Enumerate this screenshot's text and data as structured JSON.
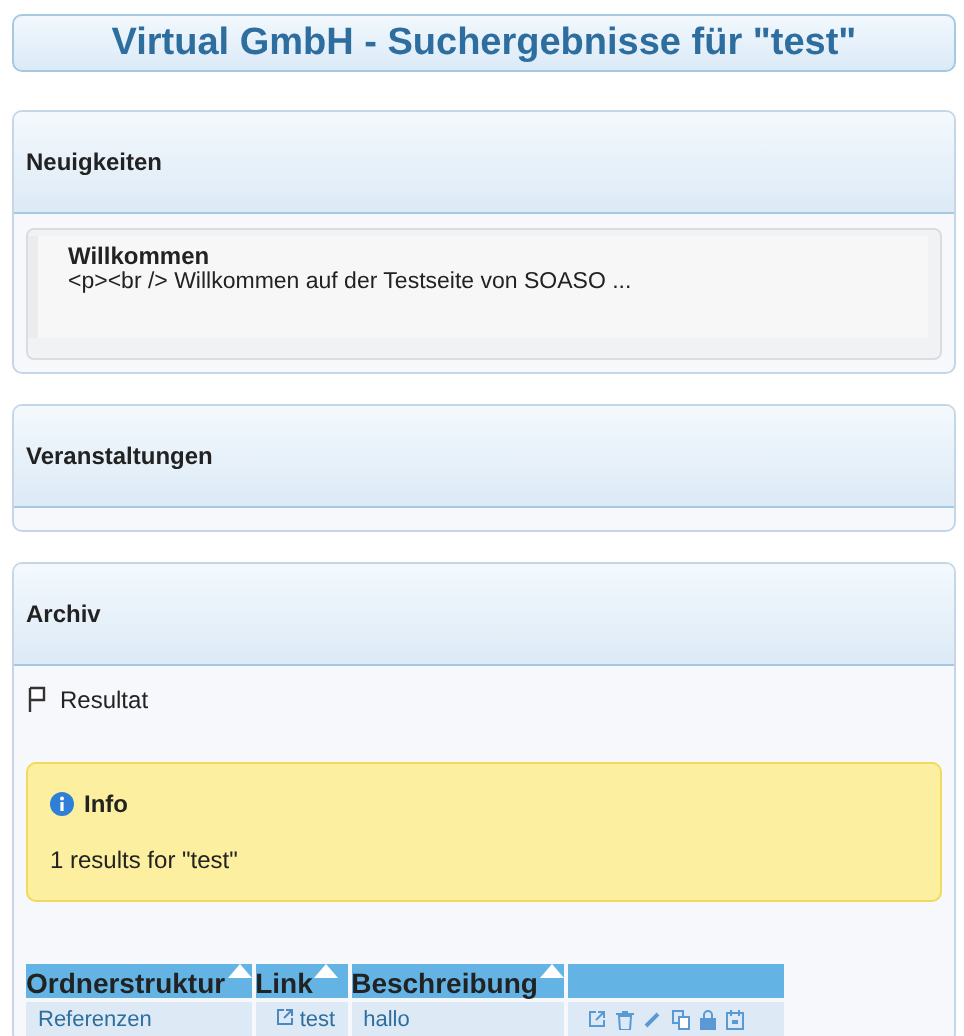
{
  "title": "Virtual GmbH - Suchergebnisse für \"test\"",
  "sections": [
    {
      "heading": "Neuigkeiten",
      "items": [
        {
          "title": "Willkommen",
          "excerpt": "<p><br /> Willkommen auf der Testseite von SOASO ..."
        }
      ]
    },
    {
      "heading": "Veranstaltungen"
    },
    {
      "heading": "Archiv",
      "result_label": "Resultat",
      "info": {
        "title": "Info",
        "message": "1 results for \"test\""
      },
      "table": {
        "columns": [
          "Ordnerstruktur",
          "Link",
          "Beschreibung"
        ],
        "rows": [
          {
            "folder": "Referenzen",
            "link": "test",
            "description": "hallo"
          }
        ]
      }
    }
  ]
}
